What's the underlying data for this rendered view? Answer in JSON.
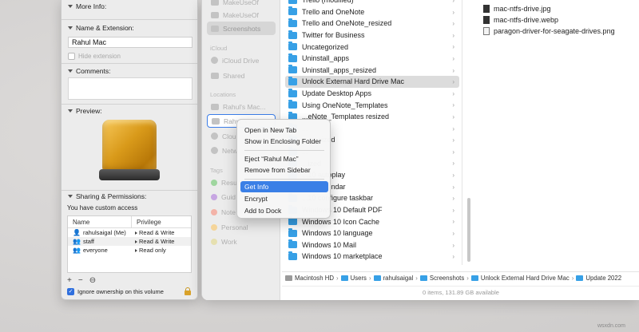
{
  "info_panel": {
    "more_info_label": "More Info:",
    "name_ext_label": "Name & Extension:",
    "name_value": "Rahul Mac",
    "hide_extension_label": "Hide extension",
    "comments_label": "Comments:",
    "preview_label": "Preview:",
    "sharing_label": "Sharing & Permissions:",
    "custom_access_text": "You have custom access",
    "table": {
      "headers": [
        "Name",
        "Privilege"
      ],
      "rows": [
        {
          "name": "rahulsaigal (Me)",
          "privilege": "Read & Write"
        },
        {
          "name": "staff",
          "privilege": "Read & Write"
        },
        {
          "name": "everyone",
          "privilege": "Read only"
        }
      ]
    },
    "add_symbol": "+",
    "remove_symbol": "−",
    "action_symbol": "⊖",
    "ignore_ownership_label": "Ignore ownership on this volume"
  },
  "finder": {
    "sidebar": {
      "favorites": [
        "MakeUseOf",
        "Screenshots"
      ],
      "icloud_header": "iCloud",
      "icloud": [
        "iCloud Drive",
        "Shared"
      ],
      "locations_header": "Locations",
      "locations": [
        "Rahul's Mac...",
        "Rahul M...",
        "Clou",
        "Netw"
      ],
      "tags_header": "Tags",
      "tags": [
        "Resu",
        "Guid",
        "Note",
        "Personal",
        "Work"
      ]
    },
    "folders": [
      "Trello (modified)",
      "Trello and OneNote",
      "Trello and OneNote_resized",
      "Twitter for Business",
      "Uncategorized",
      "Uninstall_apps",
      "Uninstall_apps_resized",
      "Unlock External Hard Drive Mac",
      "Update Desktop Apps",
      "Using OneNote_Templates",
      "...eNote_Templates resized",
      "...",
      "..._resized",
      "...",
      "...ized",
      "...10 autoplay",
      "...10 calendar",
      "...10 configure taskbar",
      "Windows 10 Default PDF",
      "Windows 10 Icon Cache",
      "Windows 10 language",
      "Windows 10 Mail",
      "Windows 10 marketplace"
    ],
    "files": [
      "mac-ntfs-drive.jpg",
      "mac-ntfs-drive.webp",
      "paragon-driver-for-seagate-drives.png"
    ],
    "path": [
      "Macintosh HD",
      "Users",
      "rahulsaigal",
      "Screenshots",
      "Unlock External Hard Drive Mac",
      "Update 2022"
    ],
    "path_separator": "›",
    "status": "0 items, 131.89 GB available"
  },
  "context_menu": {
    "items_group1": [
      "Open in New Tab",
      "Show in Enclosing Folder"
    ],
    "items_group2": [
      "Eject “Rahul Mac”",
      "Remove from Sidebar"
    ],
    "items_group3": [
      "Get Info",
      "Encrypt",
      "Add to Dock"
    ]
  },
  "watermark": "wsxdn.com",
  "colors": {
    "accent": "#3a7fe6",
    "folder": "#37a0e6",
    "drive_gold": "#d99a1a"
  }
}
